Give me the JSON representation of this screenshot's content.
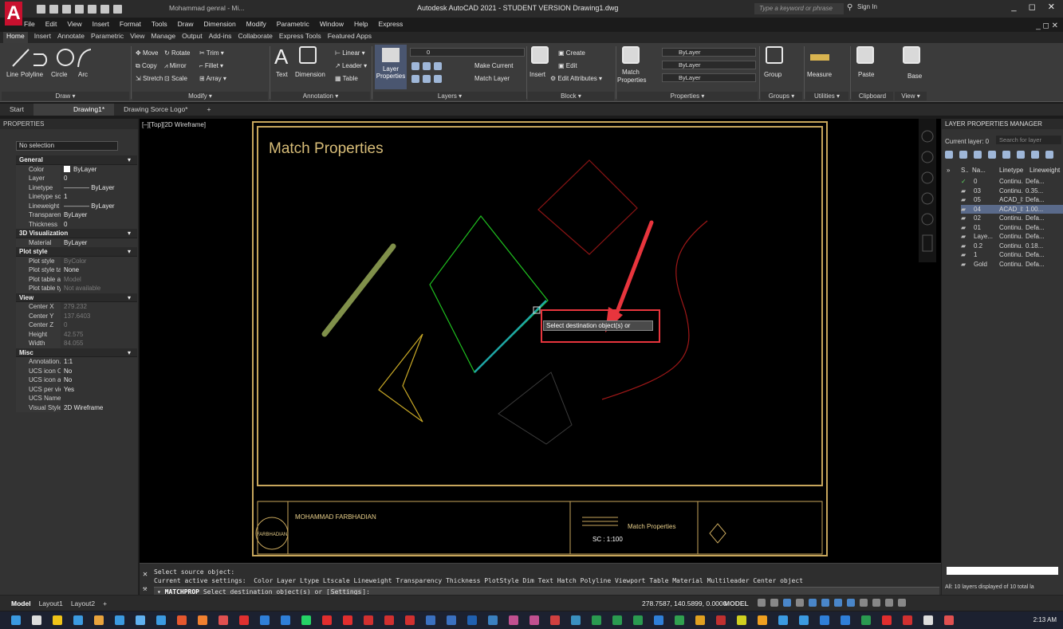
{
  "titlebar": {
    "app_letter": "A",
    "user_label": "Mohammad genral - Mi...",
    "title": "Autodesk AutoCAD 2021 - STUDENT VERSION    Drawing1.dwg",
    "search_placeholder": "Type a keyword or phrase",
    "sign_in": "Sign In",
    "window_controls": "_ ◻ ✕",
    "doc_controls": "_ ◻ ✕"
  },
  "menubar": [
    "File",
    "Edit",
    "View",
    "Insert",
    "Format",
    "Tools",
    "Draw",
    "Dimension",
    "Modify",
    "Parametric",
    "Window",
    "Help",
    "Express"
  ],
  "ribbon_tabs": [
    "Home",
    "Insert",
    "Annotate",
    "Parametric",
    "View",
    "Manage",
    "Output",
    "Add-ins",
    "Collaborate",
    "Express Tools",
    "Featured Apps"
  ],
  "ribbon": {
    "draw": {
      "line": "Line",
      "polyline": "Polyline",
      "circle": "Circle",
      "arc": "Arc",
      "title": "Draw ▾"
    },
    "modify": {
      "move": "Move",
      "rotate": "Rotate",
      "trim": "Trim ▾",
      "copy": "Copy",
      "mirror": "Mirror",
      "fillet": "Fillet ▾",
      "stretch": "Stretch",
      "scale": "Scale",
      "array": "Array ▾",
      "title": "Modify ▾"
    },
    "annotation": {
      "text": "Text",
      "dimension": "Dimension",
      "linear": "Linear ▾",
      "leader": "Leader ▾",
      "table": "Table",
      "title": "Annotation ▾"
    },
    "layers": {
      "layer_properties_1": "Layer",
      "layer_properties_2": "Properties",
      "layer_value": "0",
      "make_current": "Make Current",
      "match_layer": "Match Layer",
      "title": "Layers ▾"
    },
    "block": {
      "insert": "Insert",
      "create": "Create",
      "edit": "Edit",
      "edit_attributes": "Edit Attributes ▾",
      "title": "Block ▾"
    },
    "properties": {
      "match_1": "Match",
      "match_2": "Properties",
      "color": "ByLayer",
      "lineweight": "ByLayer",
      "linetype": "ByLayer",
      "title": "Properties ▾"
    },
    "groups": {
      "group": "Group",
      "title": "Groups ▾"
    },
    "utilities": {
      "measure": "Measure",
      "title": "Utilities ▾"
    },
    "clipboard": {
      "paste": "Paste",
      "title": "Clipboard"
    },
    "view": {
      "base": "Base",
      "title": "View ▾"
    }
  },
  "filetabs": [
    "Start",
    "Drawing1*",
    "Drawing Sorce Logo*",
    "+"
  ],
  "properties": {
    "title": "PROPERTIES",
    "selection": "No selection",
    "sections": [
      {
        "name": "General",
        "rows": [
          {
            "k": "Color",
            "v": "ByLayer",
            "swatch": true
          },
          {
            "k": "Layer",
            "v": "0"
          },
          {
            "k": "Linetype",
            "v": "———— ByLayer"
          },
          {
            "k": "Linetype scale",
            "v": "1"
          },
          {
            "k": "Lineweight",
            "v": "———— ByLayer"
          },
          {
            "k": "Transparency",
            "v": "ByLayer"
          },
          {
            "k": "Thickness",
            "v": "0"
          }
        ]
      },
      {
        "name": "3D Visualization",
        "rows": [
          {
            "k": "Material",
            "v": "ByLayer"
          }
        ]
      },
      {
        "name": "Plot style",
        "rows": [
          {
            "k": "Plot style",
            "v": "ByColor",
            "dim": true
          },
          {
            "k": "Plot style ta...",
            "v": "None"
          },
          {
            "k": "Plot table at...",
            "v": "Model",
            "dim": true
          },
          {
            "k": "Plot table ty...",
            "v": "Not available",
            "dim": true
          }
        ]
      },
      {
        "name": "View",
        "rows": [
          {
            "k": "Center X",
            "v": "279.232",
            "dim": true
          },
          {
            "k": "Center Y",
            "v": "137.6403",
            "dim": true
          },
          {
            "k": "Center Z",
            "v": "0",
            "dim": true
          },
          {
            "k": "Height",
            "v": "42.575",
            "dim": true
          },
          {
            "k": "Width",
            "v": "84.055",
            "dim": true
          }
        ]
      },
      {
        "name": "Misc",
        "rows": [
          {
            "k": "Annotation...",
            "v": "1:1"
          },
          {
            "k": "UCS icon On",
            "v": "No"
          },
          {
            "k": "UCS icon at...",
            "v": "No"
          },
          {
            "k": "UCS per vie...",
            "v": "Yes"
          },
          {
            "k": "UCS Name",
            "v": ""
          },
          {
            "k": "Visual Style",
            "v": "2D Wireframe"
          }
        ]
      }
    ]
  },
  "canvas": {
    "view_label": "[–][Top][2D Wireframe]",
    "heading": "Match Properties",
    "tooltip": "Select destination object(s) or",
    "titleblock_name": "MOHAMMAD FARBHADIAN",
    "titleblock_sheet": "Match Properties",
    "titleblock_scale": "SC : 1:100",
    "logo_text": "FARBHADIAN"
  },
  "layers": {
    "title": "LAYER PROPERTIES MANAGER",
    "current_layer": "Current layer: 0",
    "search_placeholder": "Search for layer",
    "headers": {
      "status": "S..",
      "name": "Na...",
      "linetype": "Linetype",
      "lineweight": "Lineweight"
    },
    "rows": [
      {
        "name": "0",
        "linetype": "Continu...",
        "lineweight": "Defa...",
        "current": true
      },
      {
        "name": "03",
        "linetype": "Continu...",
        "lineweight": "0.35..."
      },
      {
        "name": "05",
        "linetype": "ACAD_IS...",
        "lineweight": "Defa..."
      },
      {
        "name": "04",
        "linetype": "ACAD_IS...",
        "lineweight": "1.00...",
        "selected": true
      },
      {
        "name": "02",
        "linetype": "Continu...",
        "lineweight": "Defa..."
      },
      {
        "name": "01",
        "linetype": "Continu...",
        "lineweight": "Defa..."
      },
      {
        "name": "Laye...",
        "linetype": "Continu...",
        "lineweight": "Defa..."
      },
      {
        "name": "0.2",
        "linetype": "Continu...",
        "lineweight": "0.18..."
      },
      {
        "name": "1",
        "linetype": "Continu...",
        "lineweight": "Defa..."
      },
      {
        "name": "Gold",
        "linetype": "Continu...",
        "lineweight": "Defa..."
      }
    ],
    "footer": "All: 10 layers displayed of 10 total la"
  },
  "command": {
    "line1": "Select source object:",
    "line2": "Current active settings:  Color Layer Ltype Ltscale Lineweight Transparency Thickness PlotStyle Dim Text Hatch Polyline Viewport Table Material Multileader Center object",
    "prompt_cmd": "MATCHPROP",
    "prompt_text": " Select destination object(s) or [",
    "prompt_opt": "Settings",
    "prompt_end": "]:"
  },
  "statusbar": {
    "tabs": [
      "Model",
      "Layout1",
      "Layout2",
      "+"
    ],
    "coords": "278.7587, 140.5899, 0.0000",
    "mode": "MODEL"
  },
  "taskbar": {
    "clock": "2:13 AM"
  }
}
